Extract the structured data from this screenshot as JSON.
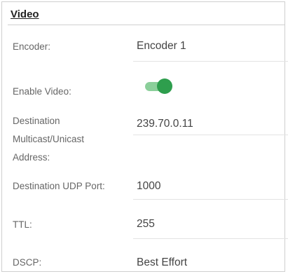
{
  "section": {
    "title": "Video"
  },
  "fields": {
    "encoder": {
      "label": "Encoder:",
      "value": "Encoder 1"
    },
    "enable_video": {
      "label": "Enable Video:",
      "checked": true,
      "accent_color": "#2e9e4d",
      "track_color": "#8bcf9a"
    },
    "destination_address": {
      "label_line1": "Destination",
      "label_line2": "Multicast/Unicast",
      "label_line3": "Address:",
      "value": "239.70.0.11"
    },
    "destination_udp_port": {
      "label": "Destination UDP Port:",
      "value": "1000"
    },
    "ttl": {
      "label": "TTL:",
      "value": "255"
    },
    "dscp": {
      "label": "DSCP:",
      "value": "Best Effort"
    }
  }
}
